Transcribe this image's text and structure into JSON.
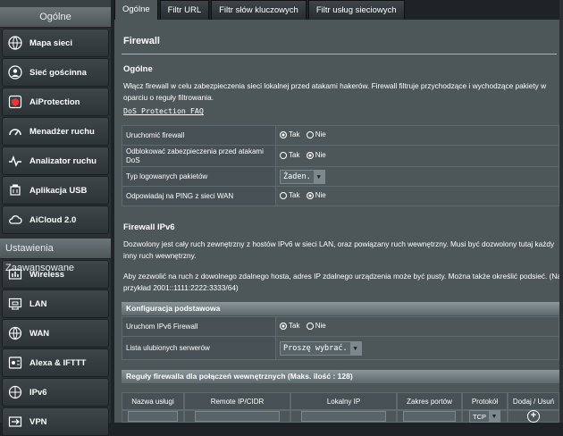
{
  "sidebar": {
    "general_title": "Ogólne",
    "general_items": [
      {
        "label": "Mapa sieci",
        "icon": "network-map-icon"
      },
      {
        "label": "Sieć gościnna",
        "icon": "guest-network-icon"
      },
      {
        "label": "AiProtection",
        "icon": "aiprotection-icon"
      },
      {
        "label": "Menadżer ruchu",
        "icon": "traffic-manager-icon"
      },
      {
        "label": "Analizator ruchu",
        "icon": "traffic-analyzer-icon"
      },
      {
        "label": "Aplikacja USB",
        "icon": "usb-application-icon"
      },
      {
        "label": "AiCloud 2.0",
        "icon": "aicloud-icon"
      }
    ],
    "advanced_title": "Ustawienia Zaawansowane",
    "advanced_items": [
      {
        "label": "Wireless",
        "icon": "wireless-icon"
      },
      {
        "label": "LAN",
        "icon": "lan-icon"
      },
      {
        "label": "WAN",
        "icon": "wan-icon"
      },
      {
        "label": "Alexa & IFTTT",
        "icon": "alexa-ifttt-icon"
      },
      {
        "label": "IPv6",
        "icon": "ipv6-icon"
      },
      {
        "label": "VPN",
        "icon": "vpn-icon"
      }
    ]
  },
  "tabs": [
    "Ogólne",
    "Filtr URL",
    "Filtr słów kluczowych",
    "Filtr usług sieciowych"
  ],
  "page": {
    "title": "Firewall",
    "general_title": "Ogólne",
    "general_desc": "Włącz firewall w celu zabezpieczenia sieci lokalnej przed atakami hakerów. Firewall filtruje przychodzące i wychodzące pakiety w oparciu o reguły filtrowania.",
    "dos_faq": "DoS Protection FAQ",
    "rows": [
      {
        "label": "Uruchomić firewall",
        "yes": "Tak",
        "no": "Nie"
      },
      {
        "label": "Odblokować zabezpieczenia przed atakami DoS",
        "yes": "Tak",
        "no": "Nie"
      },
      {
        "label": "Typ logowanych pakietów",
        "select": "Żaden."
      },
      {
        "label": "Odpowiadaj na PING z sieci WAN",
        "yes": "Tak",
        "no": "Nie"
      }
    ],
    "ipv6_title": "Firewall IPv6",
    "ipv6_desc1": "Dozwolony jest cały ruch zewnętrzny z hostów IPv6 w sieci LAN, oraz powiązany ruch wewnętrzny. Musi być dozwolony tutaj każdy inny ruch wewnętrzny.",
    "ipv6_desc2": "Aby zezwolić na ruch z dowolnego zdalnego hosta, adres IP zdalnego urządzenia może być pusty. Można także określić podsieć. (Na przykład 2001::1111:2222:3333/64)",
    "basic_config": "Konfiguracja podstawowa",
    "ipv6_rows": [
      {
        "label": "Uruchom IPv6 Firewall",
        "yes": "Tak",
        "no": "Nie"
      },
      {
        "label": "Lista ulubionych serwerów",
        "select": "Proszę wybrać."
      }
    ],
    "rules_title": "Reguły firewalla dla połączeń wewnętrznych (Maks. ilość : 128)",
    "rules_cols": [
      "Nazwa usługi",
      "Remote IP/CIDR",
      "Lokalny IP",
      "Zakres portów",
      "Protokół",
      "Dodaj / Usuń"
    ],
    "protocol_value": "TCP"
  }
}
